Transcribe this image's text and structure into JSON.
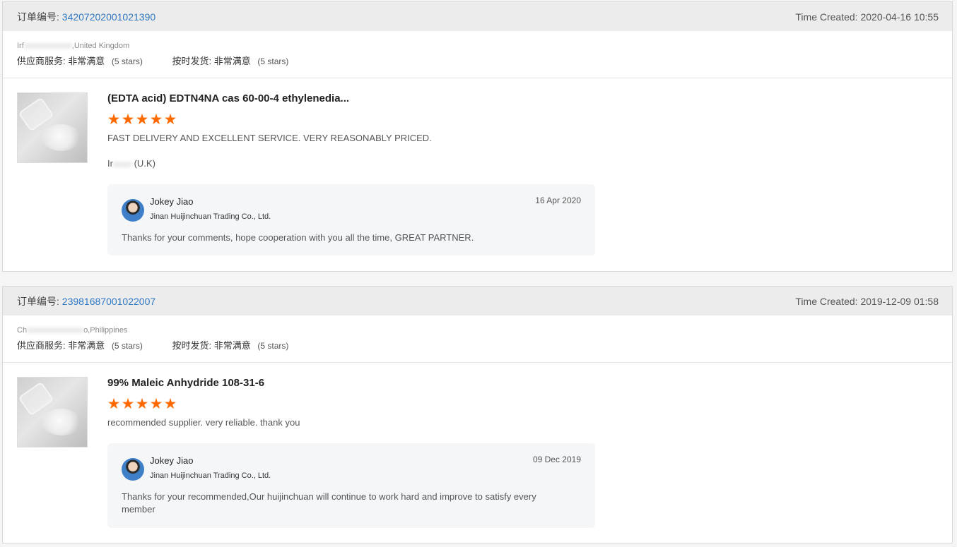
{
  "orders": [
    {
      "order_label": "订单编号:",
      "order_number": "34207202001021390",
      "time_created": "Time Created: 2020-04-16 10:55",
      "buyer_name_prefix": "Irf",
      "buyer_location": ",United Kingdom",
      "supplier_service_label": "供应商服务:",
      "supplier_service_value": "非常满意",
      "supplier_service_stars": "(5 stars)",
      "on_time_label": "按时发货:",
      "on_time_value": "非常满意",
      "on_time_stars": "(5 stars)",
      "product_title": "(EDTA acid) EDTN4NA cas 60-00-4 ethylenedia...",
      "rating": 5,
      "review_text": "FAST DELIVERY AND EXCELLENT SERVICE. VERY REASONABLY PRICED.",
      "buyer_sig_prefix": "Ir",
      "buyer_sig_suffix": "(U.K)",
      "reply": {
        "name": "Jokey Jiao",
        "company": "Jinan Huijinchuan Trading Co., Ltd.",
        "date": "16 Apr 2020",
        "text": "Thanks for your comments, hope cooperation with you all the time,  GREAT PARTNER."
      }
    },
    {
      "order_label": "订单编号:",
      "order_number": "23981687001022007",
      "time_created": "Time Created: 2019-12-09 01:58",
      "buyer_name_prefix": "Ch",
      "buyer_location": "o,Philippines",
      "supplier_service_label": "供应商服务:",
      "supplier_service_value": "非常满意",
      "supplier_service_stars": "(5 stars)",
      "on_time_label": "按时发货:",
      "on_time_value": "非常满意",
      "on_time_stars": "(5 stars)",
      "product_title": "99% Maleic Anhydride 108-31-6",
      "rating": 5,
      "review_text": "recommended supplier.  very reliable.  thank you",
      "reply": {
        "name": "Jokey Jiao",
        "company": "Jinan Huijinchuan Trading Co., Ltd.",
        "date": "09 Dec 2019",
        "text": "Thanks for your recommended,Our huijinchuan will continue to work hard and improve to satisfy every member"
      }
    }
  ],
  "colors": {
    "order_number": "#2f78c4",
    "star": "#ff6a00",
    "header_bg": "#ececec",
    "reply_bg": "#f5f6f8"
  },
  "icons": {
    "star": "star-icon",
    "avatar": "avatar",
    "product_image": "product-image"
  }
}
